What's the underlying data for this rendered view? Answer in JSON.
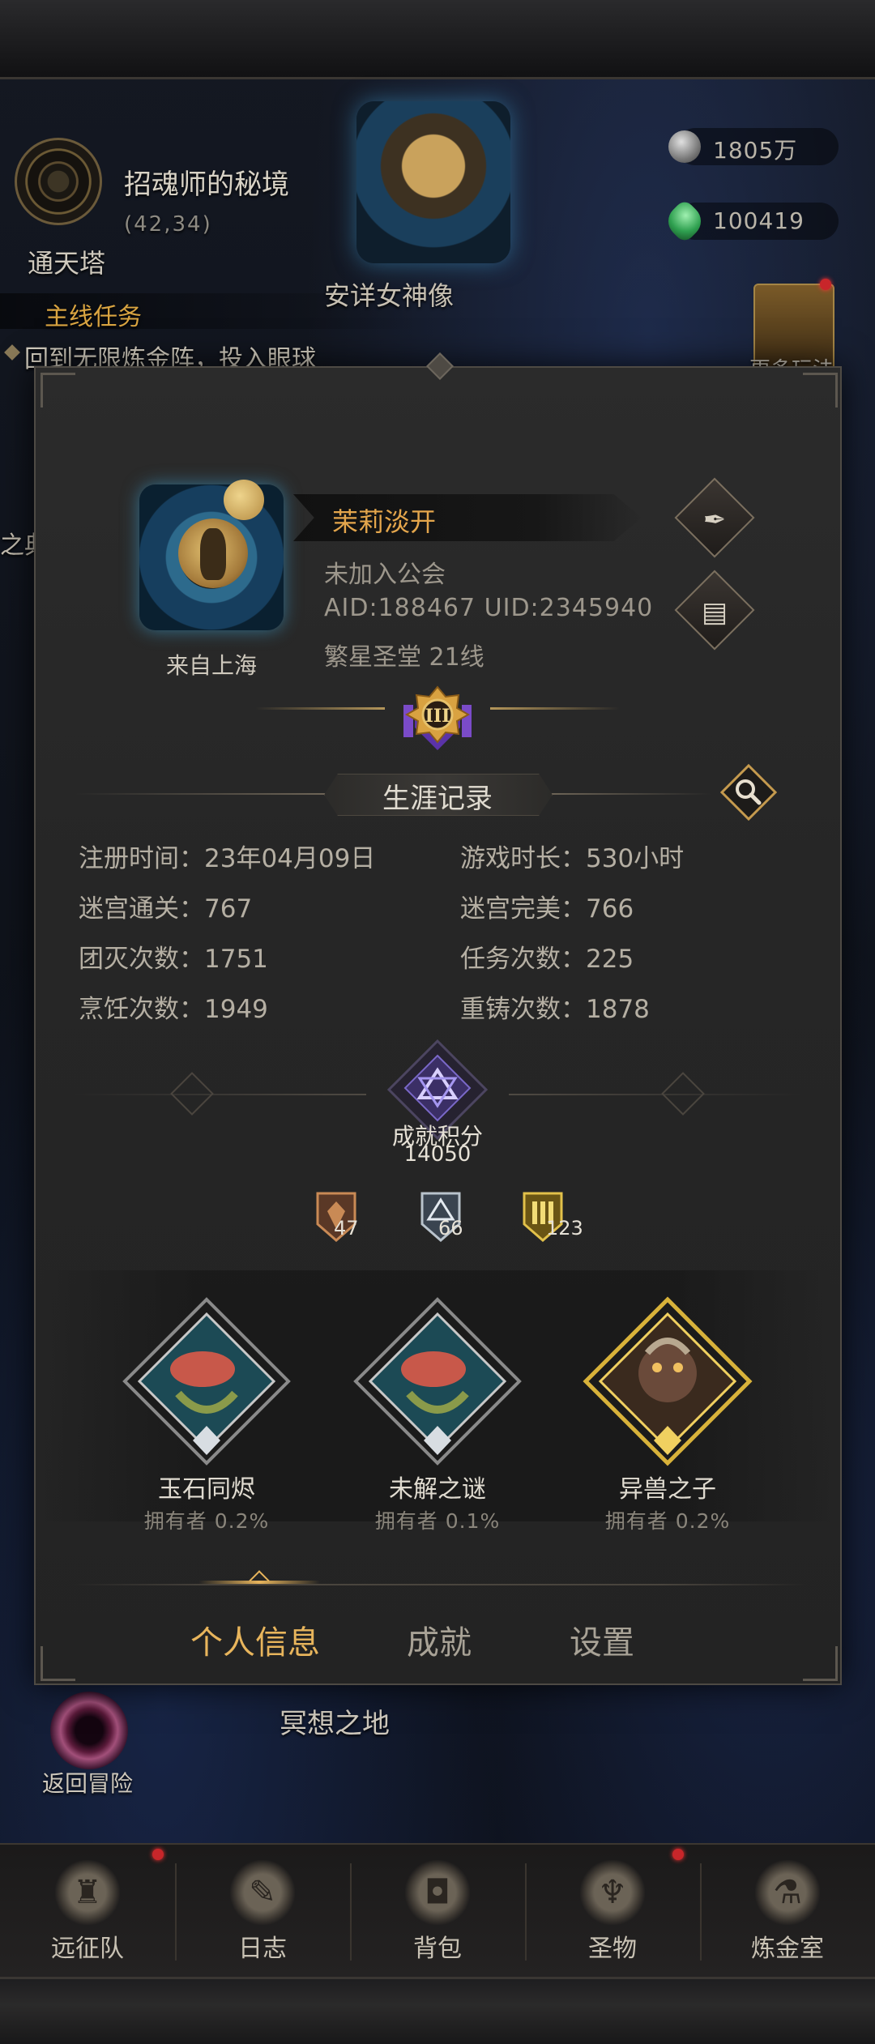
{
  "hud": {
    "location_name": "招魂师的秘境",
    "location_coords": "(42,34)",
    "tower_label": "通天塔",
    "quest_title": "主线任务",
    "quest_text": "回到无限炼金阵，投入眼球",
    "statue_label": "安详女神像",
    "currency_silver": "1805万",
    "currency_gem": "100419",
    "more_play_label": "更多玩法",
    "side_label": "之典",
    "back_to_adventure": "返回冒险",
    "meditation_label": "冥想之地"
  },
  "profile": {
    "player_name": "茉莉淡开",
    "guild": "未加入公会",
    "ids": "AID:188467 UID:2345940",
    "server": "繁星圣堂  21线",
    "from_city": "来自上海",
    "rank_numeral": "III"
  },
  "career": {
    "title": "生涯记录",
    "stats": [
      {
        "label": "注册时间：",
        "value": "23年04月09日"
      },
      {
        "label": "游戏时长：",
        "value": "530小时"
      },
      {
        "label": "迷宫通关：",
        "value": "767"
      },
      {
        "label": "迷宫完美：",
        "value": "766"
      },
      {
        "label": "团灭次数：",
        "value": "1751"
      },
      {
        "label": "任务次数：",
        "value": "225"
      },
      {
        "label": "烹饪次数：",
        "value": "1949"
      },
      {
        "label": "重铸次数：",
        "value": "1878"
      }
    ]
  },
  "achievements": {
    "label": "成就积分",
    "score": "14050",
    "tiers": [
      {
        "name": "bronze",
        "count": "47",
        "color": "#c98a55"
      },
      {
        "name": "silver",
        "count": "66",
        "color": "#b9c3cc"
      },
      {
        "name": "gold",
        "count": "123",
        "color": "#e2c14a"
      }
    ],
    "featured": [
      {
        "name": "玉石同烬",
        "owners": "拥有者  0.2%",
        "tier": "silver"
      },
      {
        "name": "未解之谜",
        "owners": "拥有者  0.1%",
        "tier": "silver"
      },
      {
        "name": "异兽之子",
        "owners": "拥有者  0.2%",
        "tier": "gold"
      }
    ]
  },
  "tabs": [
    {
      "label": "个人信息",
      "active": true
    },
    {
      "label": "成就",
      "active": false
    },
    {
      "label": "设置",
      "active": false
    }
  ],
  "nav": [
    {
      "label": "远征队",
      "icon": "helmet-icon",
      "badge": true
    },
    {
      "label": "日志",
      "icon": "scroll-icon",
      "badge": false
    },
    {
      "label": "背包",
      "icon": "bag-icon",
      "badge": false
    },
    {
      "label": "圣物",
      "icon": "chalice-icon",
      "badge": true
    },
    {
      "label": "炼金室",
      "icon": "alchemy-icon",
      "badge": false
    }
  ],
  "colors": {
    "accent_gold": "#e4a64c",
    "text_muted": "#9d978c",
    "alert_red": "#c8262a"
  }
}
